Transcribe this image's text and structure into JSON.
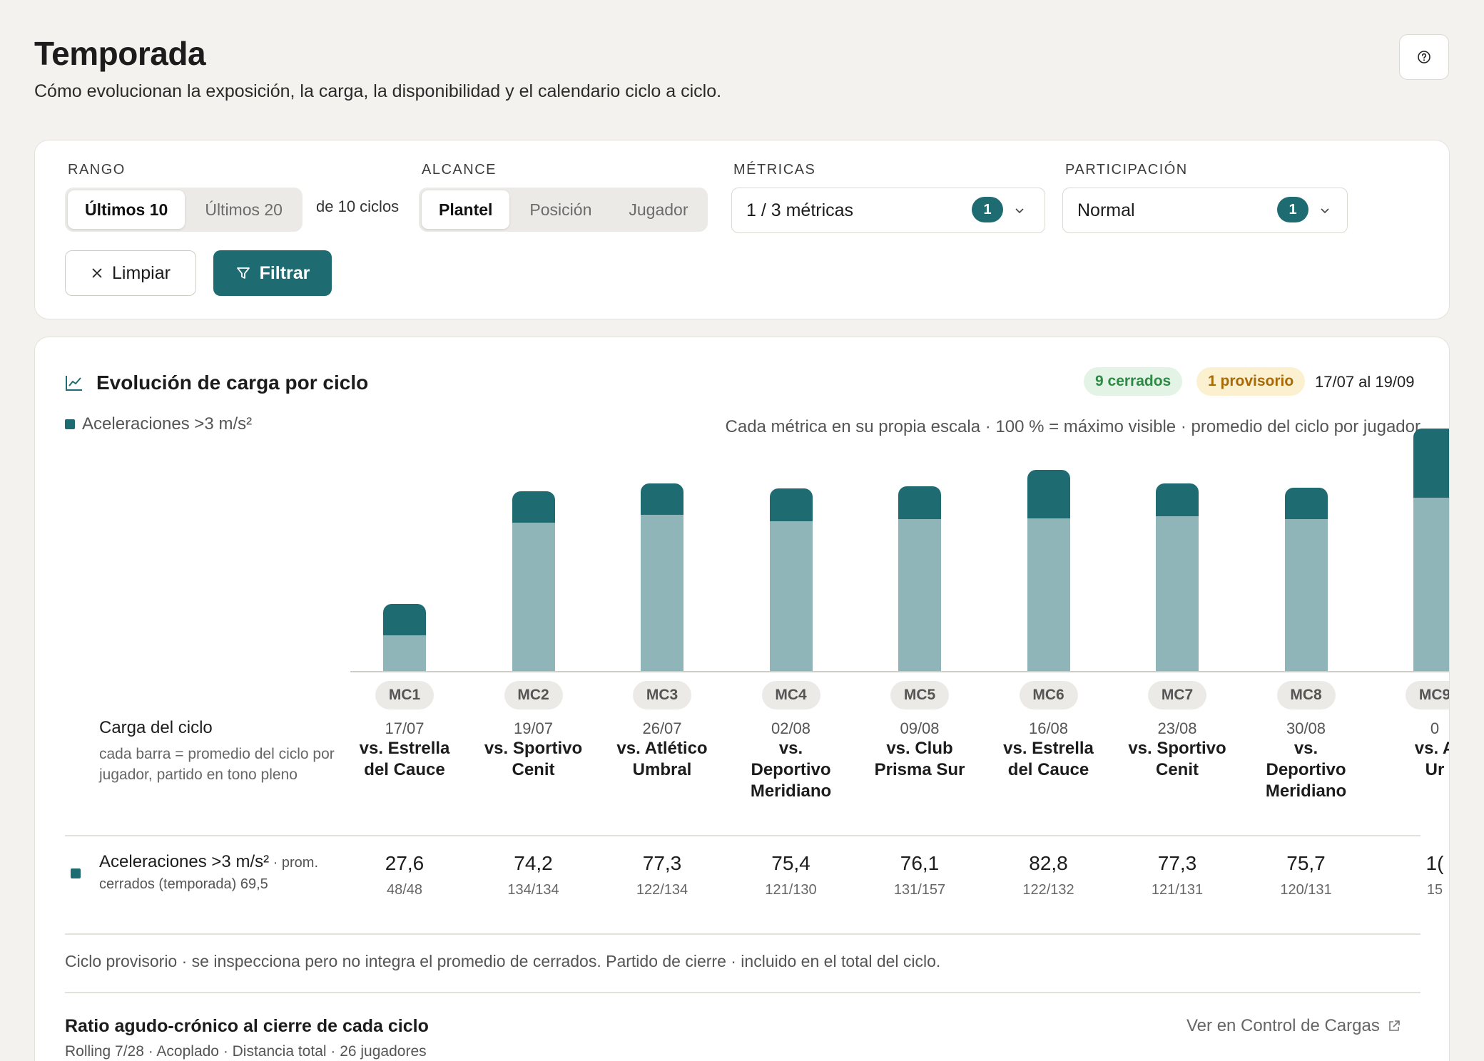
{
  "header": {
    "title": "Temporada",
    "subtitle": "Cómo evolucionan la exposición, la carga, la disponibilidad y el calendario ciclo a ciclo."
  },
  "filters": {
    "range": {
      "label": "RANGO",
      "options": [
        "Últimos 10",
        "Últimos 20"
      ],
      "selected": "Últimos 10",
      "note": "de 10 ciclos"
    },
    "scope": {
      "label": "ALCANCE",
      "options": [
        "Plantel",
        "Posición",
        "Jugador"
      ],
      "selected": "Plantel"
    },
    "metrics": {
      "label": "MÉTRICAS",
      "value": "1 / 3 métricas",
      "badge": "1"
    },
    "participation": {
      "label": "PARTICIPACIÓN",
      "value": "Normal",
      "badge": "1"
    },
    "clear_label": "Limpiar",
    "filter_label": "Filtrar"
  },
  "chart_card": {
    "title": "Evolución de carga por ciclo",
    "closed_badge": "9 cerrados",
    "provisional_badge": "1 provisorio",
    "date_range": "17/07 al 19/09",
    "legend": "Aceleraciones >3 m/s²",
    "scale_note": "Cada métrica en su propia escala · 100 % = máximo visible · promedio del ciclo por jugador",
    "row_header_title": "Carga del ciclo",
    "row_header_sub": "cada barra = promedio del ciclo por jugador, partido en tono pleno",
    "metric_name": "Aceleraciones >3 m/s²",
    "metric_suffix": " · prom.",
    "metric_sub": "cerrados (temporada) 69,5",
    "footnote": "Ciclo provisorio · se inspecciona pero no integra el promedio de cerrados. Partido de cierre · incluido en el total del ciclo.",
    "acr_title": "Ratio agudo-crónico al cierre de cada ciclo",
    "acr_sub": "Rolling 7/28 · Acoplado · Distancia total · 26 jugadores",
    "acr_link": "Ver en Control de Cargas"
  },
  "chart_data": {
    "type": "bar",
    "stacked": true,
    "ylim": [
      0,
      100
    ],
    "categories": [
      "MC1",
      "MC2",
      "MC3",
      "MC4",
      "MC5",
      "MC6",
      "MC7",
      "MC8",
      "MC9"
    ],
    "dates": [
      "17/07",
      "19/07",
      "26/07",
      "02/08",
      "09/08",
      "16/08",
      "23/08",
      "30/08",
      "0"
    ],
    "opponents": [
      [
        "vs. Estrella",
        "del Cauce"
      ],
      [
        "vs. Sportivo",
        "Cenit"
      ],
      [
        "vs. Atlético",
        "Umbral"
      ],
      [
        "vs.",
        "Deportivo",
        "Meridiano"
      ],
      [
        "vs. Club",
        "Prisma Sur"
      ],
      [
        "vs. Estrella",
        "del Cauce"
      ],
      [
        "vs. Sportivo",
        "Cenit"
      ],
      [
        "vs.",
        "Deportivo",
        "Meridiano"
      ],
      [
        "vs. A",
        "Ur"
      ]
    ],
    "values": [
      "27,6",
      "74,2",
      "77,3",
      "75,4",
      "76,1",
      "82,8",
      "77,3",
      "75,7",
      "1("
    ],
    "counts": [
      "48/48",
      "134/134",
      "122/134",
      "121/130",
      "131/157",
      "122/132",
      "121/131",
      "120/131",
      "15"
    ],
    "total_pct": [
      27.6,
      74.2,
      77.3,
      75.4,
      76.1,
      82.8,
      77.3,
      75.7,
      100
    ],
    "match_pct": [
      13.0,
      13.0,
      13.0,
      13.5,
      13.5,
      20.0,
      13.5,
      13.0,
      28.5
    ]
  }
}
